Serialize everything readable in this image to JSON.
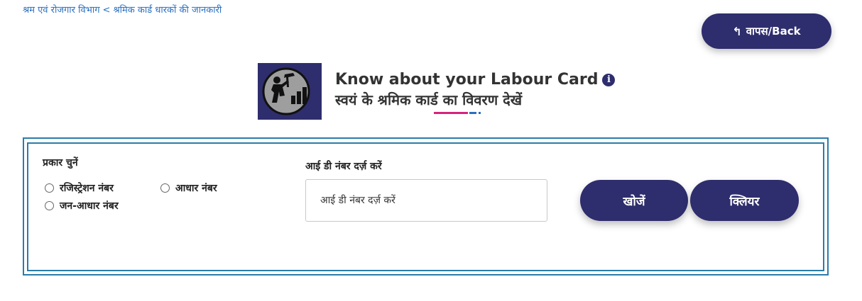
{
  "breadcrumb": {
    "parent": "श्रम एवं रोजगार विभाग",
    "separator": "<",
    "current": "श्रमिक कार्ड धारकों की जानकारी"
  },
  "back_button": {
    "arrow": "↰",
    "label": "वापस/Back"
  },
  "header": {
    "title_en": "Know about your Labour Card",
    "title_hi": "स्वयं के श्रमिक कार्ड का विवरण देखें",
    "info_icon": "i"
  },
  "form": {
    "type_label": "प्रकार चुनें",
    "options": [
      "रजिस्ट्रेशन नंबर",
      "आधार नंबर",
      "जन-आधार नंबर"
    ],
    "id_label": "आई डी नंबर दर्ज़ करें",
    "id_input": {
      "value": "",
      "placeholder": "आई डी नंबर दर्ज़ करें"
    },
    "search_label": "खोजें",
    "clear_label": "क्लियर"
  },
  "colors": {
    "primary": "#2e2d6d",
    "border": "#2b7ca8",
    "link": "#2a6fc0",
    "accent_pink": "#d6247d"
  }
}
